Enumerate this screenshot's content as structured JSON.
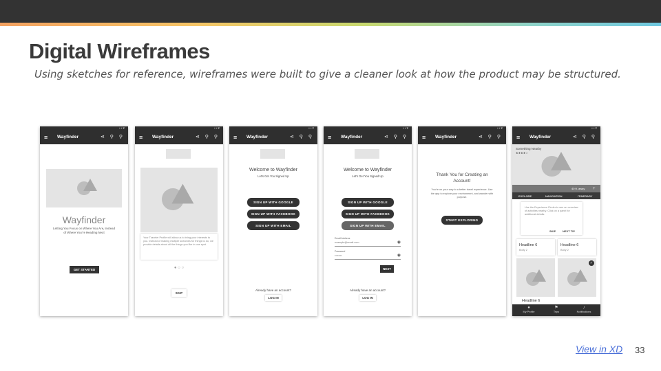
{
  "slide": {
    "title": "Digital Wireframes",
    "subtitle": "Using sketches for reference, wireframes were built to give a cleaner look at how the product may be structured.",
    "link": "View in XD",
    "page_number": "33"
  },
  "app": {
    "name": "Wayfinder",
    "status_icons": "▪▪▾",
    "menu_icon": "≡",
    "action_icons": "⋖ ⚲ ⚲"
  },
  "screen1": {
    "brand": "Wayfinder",
    "tagline": "Letting You Focus on Where You Are, Instead of Where You're Heading Next",
    "cta": "GET STARTED"
  },
  "screen2": {
    "body": "Your Traveler Profile will allow us to bring your interests to you. Instead of making multiple searches for things to do, we provide details about all the things you like in one spot.",
    "dots": "●  ○  ○",
    "skip": "SKIP"
  },
  "screen3": {
    "heading": "Welcome to Wayfinder",
    "sub": "Let's Get You Signed Up",
    "btn_google": "SIGN UP WITH GOOGLE",
    "btn_facebook": "SIGN UP WITH FACEBOOK",
    "btn_email": "SIGN UP WITH EMAIL",
    "have_account": "Already have an account?",
    "login": "LOG IN"
  },
  "screen4": {
    "heading": "Welcome to Wayfinder",
    "sub": "Let's Get You Signed Up",
    "btn_google": "SIGN UP WITH GOOGLE",
    "btn_facebook": "SIGN UP WITH FACEBOOK",
    "btn_email": "SIGN UP WITH EMAIL",
    "email_label": "Email Address",
    "email_value": "example@email.com",
    "password_label": "Password",
    "password_value": "••••••••",
    "next": "NEXT",
    "have_account": "Already have an account?",
    "login": "LOG IN"
  },
  "screen5": {
    "heading": "Thank You for Creating an Account!",
    "body": "You're on your way to a better travel experience. Use the app to explore your environment, and wander with purpose.",
    "cta": "START EXPLORING"
  },
  "screen6": {
    "nearby_title": "Something Nearby",
    "stars": "★★★★☆",
    "distance": "40 ft. away",
    "plus": "+",
    "tabs": [
      "EXPLORE",
      "NAVIGATION",
      "ITINERARY"
    ],
    "tip_text": "Use the Experience Finder to see an overview of activities nearby. Click on a panel for additional details.",
    "tip_skip": "SKIP",
    "tip_next": "NEXT TIP",
    "card_heading": "Headline 6",
    "card_body": "Body 2",
    "nav": [
      "My Profile",
      "Trips",
      "Notifications"
    ]
  }
}
